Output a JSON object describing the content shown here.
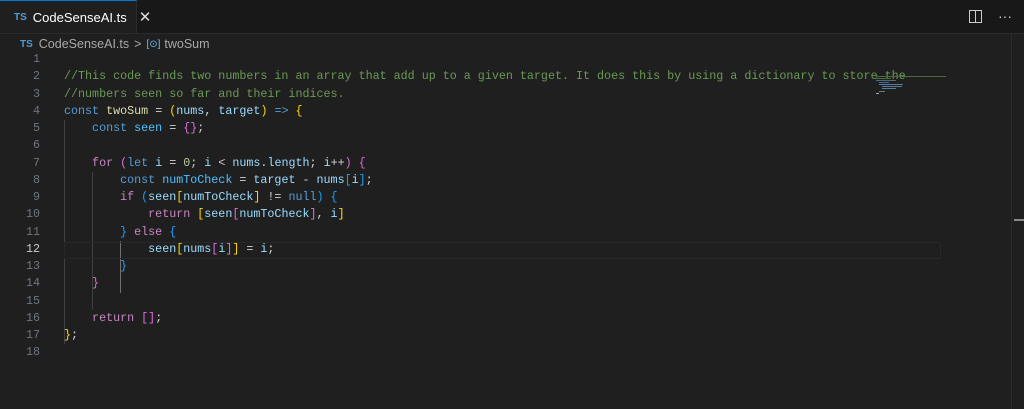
{
  "tab": {
    "lang": "TS",
    "title": "CodeSenseAI.ts",
    "close": "✕"
  },
  "actions": {
    "more": "···"
  },
  "breadcrumb": {
    "lang": "TS",
    "file": "CodeSenseAI.ts",
    "sep": ">",
    "symbol_icon": "[⊙]",
    "symbol": "twoSum"
  },
  "current_line": 12,
  "lines": [
    [],
    [
      [
        "//This code finds two numbers in an array that add up to a given target. It does this by using a dictionary to store the",
        "cm"
      ]
    ],
    [
      [
        "//numbers seen so far and their indices.",
        "cm"
      ]
    ],
    [
      [
        "const ",
        "kw"
      ],
      [
        "twoSum",
        "fn"
      ],
      [
        " = ",
        "op"
      ],
      [
        "(",
        "b1"
      ],
      [
        "nums",
        "var"
      ],
      [
        ", ",
        "op"
      ],
      [
        "target",
        "var"
      ],
      [
        ")",
        "b1"
      ],
      [
        " => ",
        "kw"
      ],
      [
        "{",
        "b1"
      ]
    ],
    [
      [
        "    const ",
        "kw"
      ],
      [
        "seen",
        "cst"
      ],
      [
        " = ",
        "op"
      ],
      [
        "{}",
        "b2"
      ],
      [
        ";",
        "op"
      ]
    ],
    [],
    [
      [
        "    for ",
        "ctl"
      ],
      [
        "(",
        "b2"
      ],
      [
        "let ",
        "kw"
      ],
      [
        "i",
        "var"
      ],
      [
        " = ",
        "op"
      ],
      [
        "0",
        "num"
      ],
      [
        "; ",
        "op"
      ],
      [
        "i",
        "var"
      ],
      [
        " < ",
        "op"
      ],
      [
        "nums",
        "var"
      ],
      [
        ".",
        "op"
      ],
      [
        "length",
        "var"
      ],
      [
        "; ",
        "op"
      ],
      [
        "i",
        "var"
      ],
      [
        "++",
        "op"
      ],
      [
        ")",
        "b2"
      ],
      [
        " {",
        "b2"
      ]
    ],
    [
      [
        "        const ",
        "kw"
      ],
      [
        "numToCheck",
        "cst"
      ],
      [
        " = ",
        "op"
      ],
      [
        "target",
        "var"
      ],
      [
        " - ",
        "op"
      ],
      [
        "nums",
        "var"
      ],
      [
        "[",
        "b3"
      ],
      [
        "i",
        "var"
      ],
      [
        "]",
        "b3"
      ],
      [
        ";",
        "op"
      ]
    ],
    [
      [
        "        if ",
        "ctl"
      ],
      [
        "(",
        "b3"
      ],
      [
        "seen",
        "var"
      ],
      [
        "[",
        "b1"
      ],
      [
        "numToCheck",
        "var"
      ],
      [
        "]",
        "b1"
      ],
      [
        " != ",
        "op"
      ],
      [
        "null",
        "kw"
      ],
      [
        ")",
        "b3"
      ],
      [
        " {",
        "b3"
      ]
    ],
    [
      [
        "            return ",
        "ctl"
      ],
      [
        "[",
        "b1"
      ],
      [
        "seen",
        "var"
      ],
      [
        "[",
        "b2"
      ],
      [
        "numToCheck",
        "var"
      ],
      [
        "]",
        "b2"
      ],
      [
        ", ",
        "op"
      ],
      [
        "i",
        "var"
      ],
      [
        "]",
        "b1"
      ]
    ],
    [
      [
        "        } ",
        "b3"
      ],
      [
        "else ",
        "ctl"
      ],
      [
        "{",
        "b3"
      ]
    ],
    [
      [
        "            seen",
        "var"
      ],
      [
        "[",
        "b1"
      ],
      [
        "nums",
        "var"
      ],
      [
        "[",
        "b2"
      ],
      [
        "i",
        "var"
      ],
      [
        "]",
        "b2"
      ],
      [
        "]",
        "b1"
      ],
      [
        " = ",
        "op"
      ],
      [
        "i",
        "var"
      ],
      [
        ";",
        "op"
      ]
    ],
    [
      [
        "        }",
        "b3"
      ]
    ],
    [
      [
        "    }",
        "b2"
      ]
    ],
    [],
    [
      [
        "    return ",
        "ctl"
      ],
      [
        "[]",
        "b2"
      ],
      [
        ";",
        "op"
      ]
    ],
    [
      [
        "}",
        "b1"
      ],
      [
        ";",
        "op"
      ]
    ],
    []
  ]
}
